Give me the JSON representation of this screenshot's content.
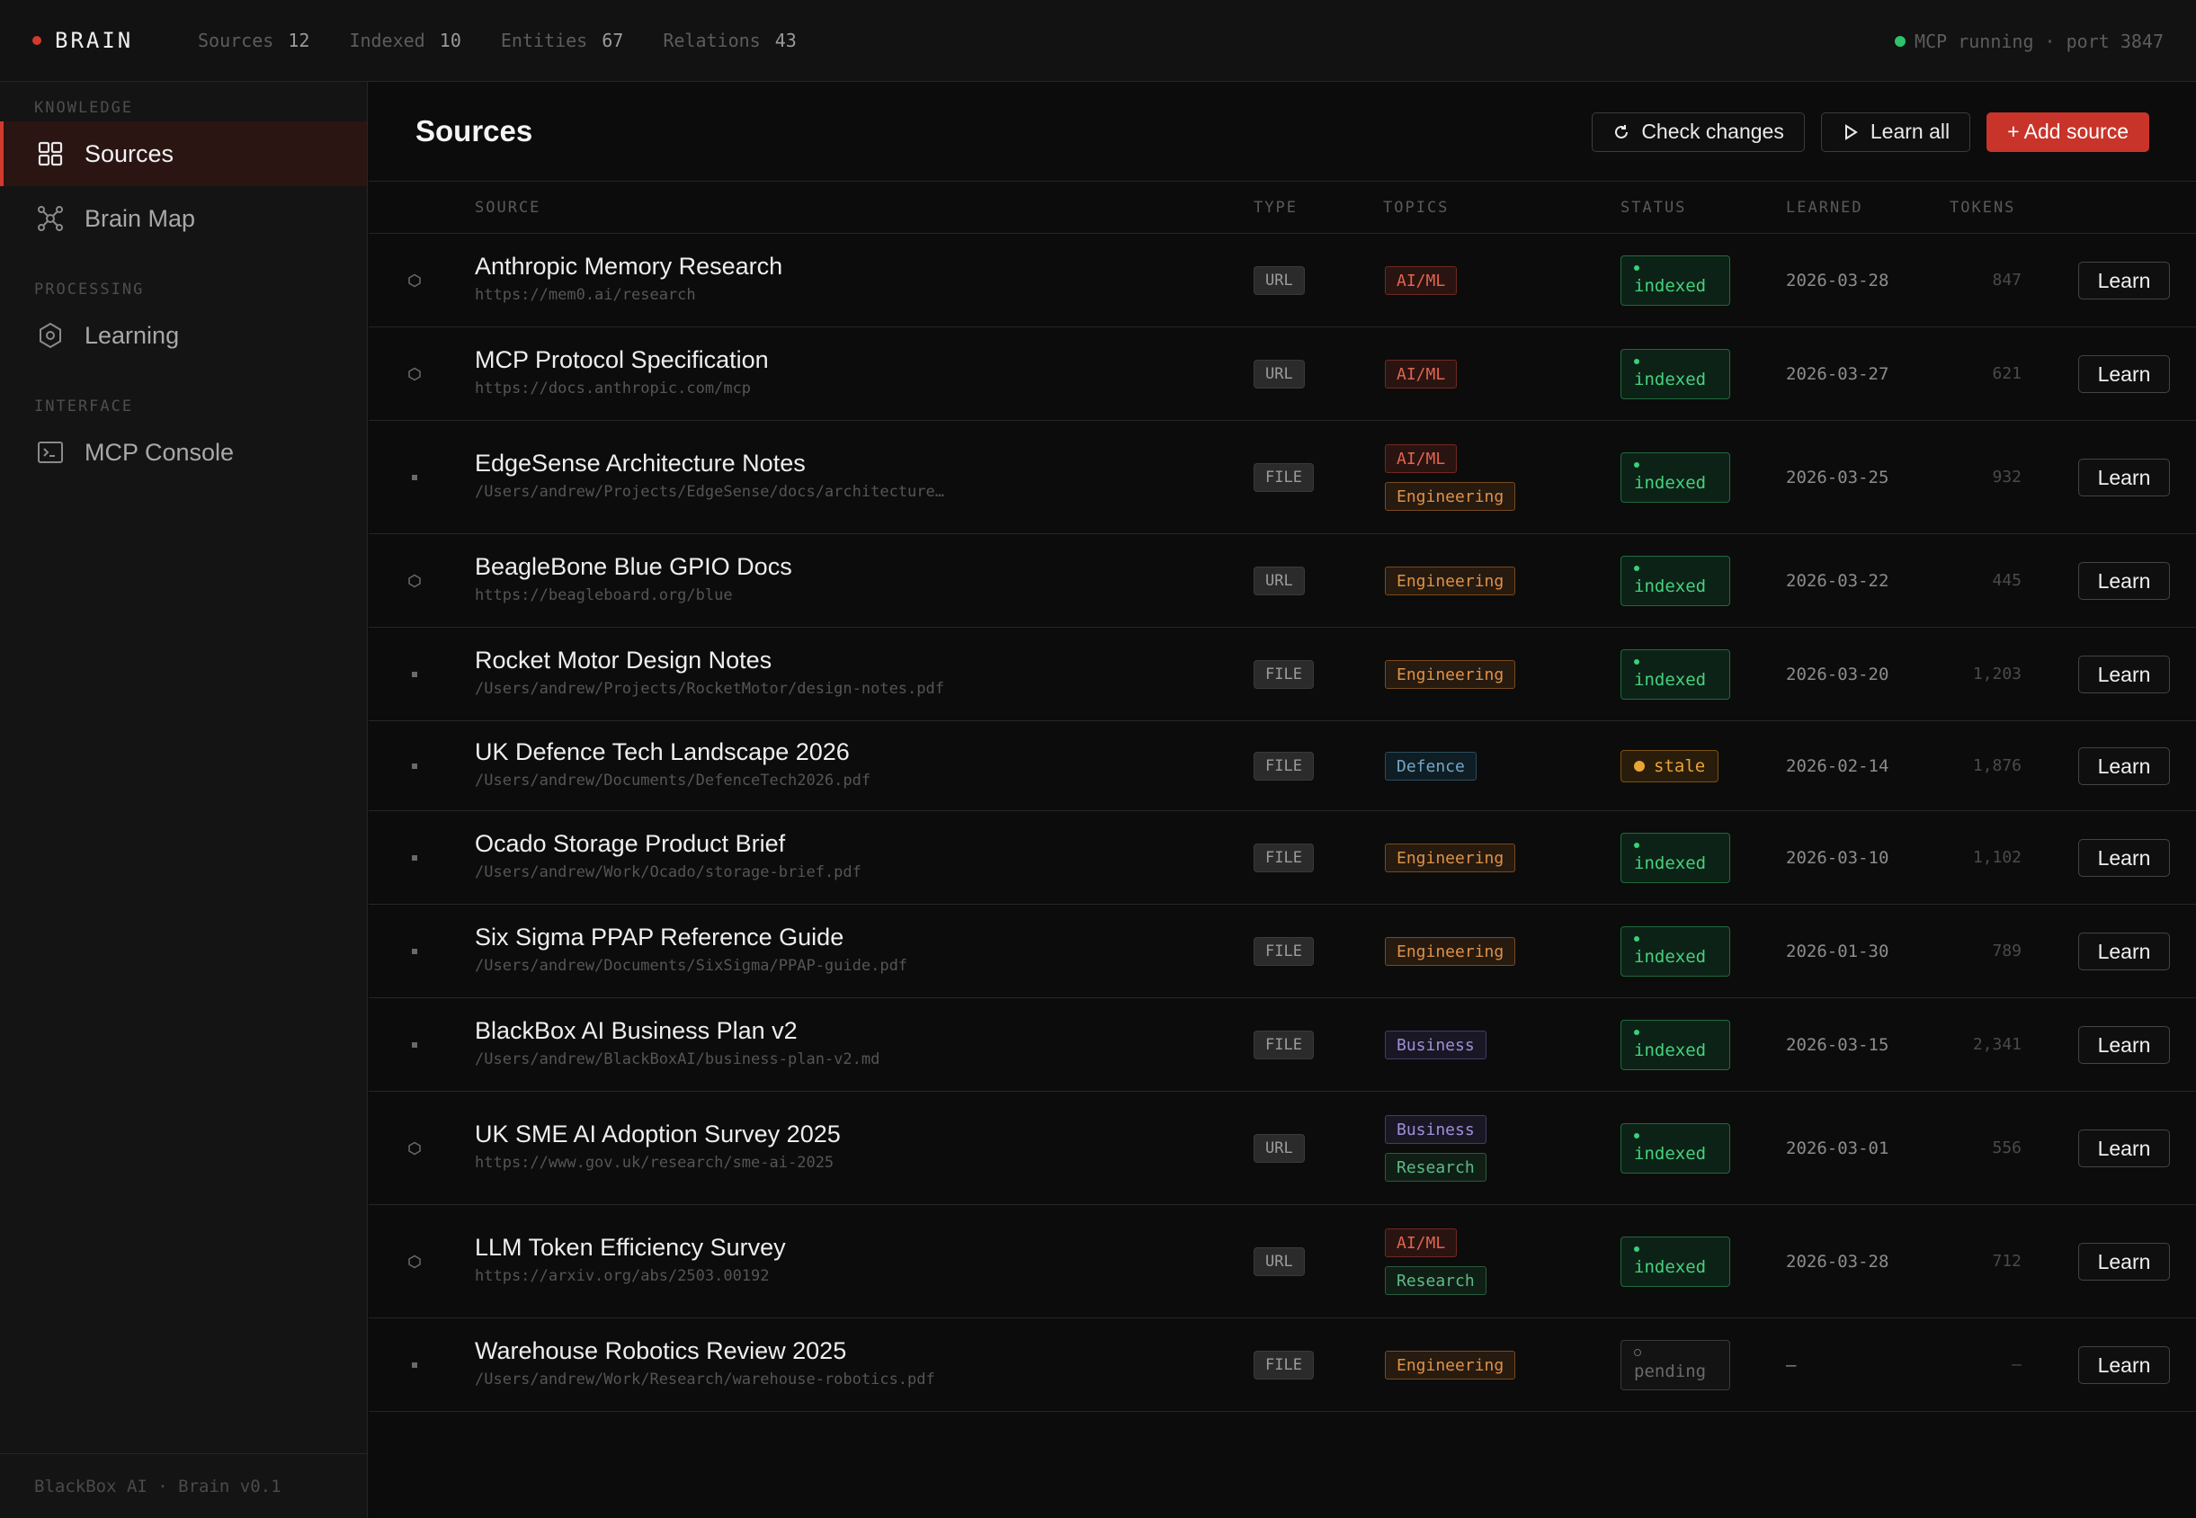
{
  "app": {
    "brand": "BRAIN",
    "stats": [
      {
        "label": "Sources",
        "value": "12"
      },
      {
        "label": "Indexed",
        "value": "10"
      },
      {
        "label": "Entities",
        "value": "67"
      },
      {
        "label": "Relations",
        "value": "43"
      }
    ],
    "server_status": "MCP running · port 3847",
    "colors": {
      "accent": "#d23a2e",
      "status_ok": "#2ec26a"
    }
  },
  "sidebar": {
    "sections": [
      {
        "label": "KNOWLEDGE",
        "items": [
          {
            "label": "Sources",
            "icon": "grid-icon",
            "active": true
          },
          {
            "label": "Brain Map",
            "icon": "graph-icon",
            "active": false
          }
        ]
      },
      {
        "label": "PROCESSING",
        "items": [
          {
            "label": "Learning",
            "icon": "hexagon-icon",
            "active": false
          }
        ]
      },
      {
        "label": "INTERFACE",
        "items": [
          {
            "label": "MCP Console",
            "icon": "terminal-icon",
            "active": false
          }
        ]
      }
    ],
    "footer": "BlackBox AI · Brain v0.1"
  },
  "main": {
    "title": "Sources",
    "actions": {
      "check": "Check changes",
      "learn_all": "Learn all",
      "add": "+ Add source"
    },
    "columns": {
      "source": "SOURCE",
      "type": "TYPE",
      "topics": "TOPICS",
      "status": "STATUS",
      "learned": "LEARNED",
      "tokens": "TOKENS"
    },
    "learn_label": "Learn",
    "rows": [
      {
        "title": "Anthropic Memory Research",
        "path": "https://mem0.ai/research",
        "type": "URL",
        "topics": [
          "AI/ML"
        ],
        "status": "indexed",
        "learned": "2026-03-28",
        "tokens": "847"
      },
      {
        "title": "MCP Protocol Specification",
        "path": "https://docs.anthropic.com/mcp",
        "type": "URL",
        "topics": [
          "AI/ML"
        ],
        "status": "indexed",
        "learned": "2026-03-27",
        "tokens": "621"
      },
      {
        "title": "EdgeSense Architecture Notes",
        "path": "/Users/andrew/Projects/EdgeSense/docs/architecture…",
        "type": "FILE",
        "topics": [
          "AI/ML",
          "Engineering"
        ],
        "status": "indexed",
        "learned": "2026-03-25",
        "tokens": "932"
      },
      {
        "title": "BeagleBone Blue GPIO Docs",
        "path": "https://beagleboard.org/blue",
        "type": "URL",
        "topics": [
          "Engineering"
        ],
        "status": "indexed",
        "learned": "2026-03-22",
        "tokens": "445"
      },
      {
        "title": "Rocket Motor Design Notes",
        "path": "/Users/andrew/Projects/RocketMotor/design-notes.pdf",
        "type": "FILE",
        "topics": [
          "Engineering"
        ],
        "status": "indexed",
        "learned": "2026-03-20",
        "tokens": "1,203"
      },
      {
        "title": "UK Defence Tech Landscape 2026",
        "path": "/Users/andrew/Documents/DefenceTech2026.pdf",
        "type": "FILE",
        "topics": [
          "Defence"
        ],
        "status": "stale",
        "learned": "2026-02-14",
        "tokens": "1,876"
      },
      {
        "title": "Ocado Storage Product Brief",
        "path": "/Users/andrew/Work/Ocado/storage-brief.pdf",
        "type": "FILE",
        "topics": [
          "Engineering"
        ],
        "status": "indexed",
        "learned": "2026-03-10",
        "tokens": "1,102"
      },
      {
        "title": "Six Sigma PPAP Reference Guide",
        "path": "/Users/andrew/Documents/SixSigma/PPAP-guide.pdf",
        "type": "FILE",
        "topics": [
          "Engineering"
        ],
        "status": "indexed",
        "learned": "2026-01-30",
        "tokens": "789"
      },
      {
        "title": "BlackBox AI Business Plan v2",
        "path": "/Users/andrew/BlackBoxAI/business-plan-v2.md",
        "type": "FILE",
        "topics": [
          "Business"
        ],
        "status": "indexed",
        "learned": "2026-03-15",
        "tokens": "2,341"
      },
      {
        "title": "UK SME AI Adoption Survey 2025",
        "path": "https://www.gov.uk/research/sme-ai-2025",
        "type": "URL",
        "topics": [
          "Business",
          "Research"
        ],
        "status": "indexed",
        "learned": "2026-03-01",
        "tokens": "556"
      },
      {
        "title": "LLM Token Efficiency Survey",
        "path": "https://arxiv.org/abs/2503.00192",
        "type": "URL",
        "topics": [
          "AI/ML",
          "Research"
        ],
        "status": "indexed",
        "learned": "2026-03-28",
        "tokens": "712"
      },
      {
        "title": "Warehouse Robotics Review 2025",
        "path": "/Users/andrew/Work/Research/warehouse-robotics.pdf",
        "type": "FILE",
        "topics": [
          "Engineering"
        ],
        "status": "pending",
        "learned": "—",
        "tokens": "—"
      }
    ]
  }
}
